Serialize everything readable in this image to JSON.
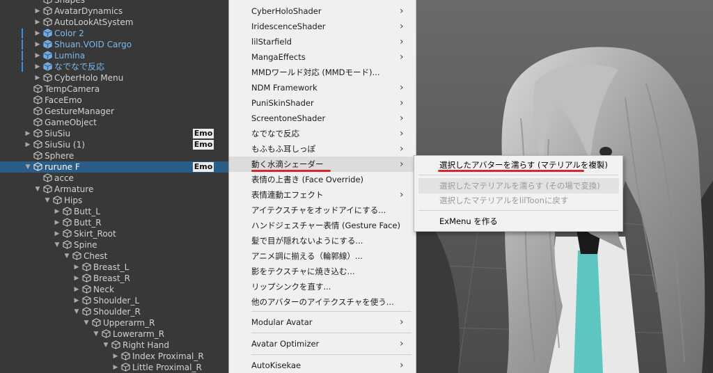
{
  "hierarchy": {
    "rows": [
      {
        "label": "Shapes",
        "indent": 0,
        "arrow": "",
        "style": "normal",
        "mark": false,
        "badge": ""
      },
      {
        "label": "AvatarDynamics",
        "indent": 0,
        "arrow": "right",
        "style": "normal",
        "mark": false,
        "badge": ""
      },
      {
        "label": "AutoLookAtSystem",
        "indent": 0,
        "arrow": "right",
        "style": "normal",
        "mark": false,
        "badge": ""
      },
      {
        "label": "Color 2",
        "indent": 0,
        "arrow": "right",
        "style": "blue",
        "mark": true,
        "badge": ""
      },
      {
        "label": "Shuan.VOID Cargo",
        "indent": 0,
        "arrow": "right",
        "style": "blue",
        "mark": true,
        "badge": ""
      },
      {
        "label": "Lumina",
        "indent": 0,
        "arrow": "right",
        "style": "blue",
        "mark": true,
        "badge": ""
      },
      {
        "label": "なでなで反応",
        "indent": 0,
        "arrow": "right",
        "style": "blue",
        "mark": true,
        "badge": ""
      },
      {
        "label": "CyberHolo Menu",
        "indent": 0,
        "arrow": "right",
        "style": "normal",
        "mark": false,
        "badge": ""
      },
      {
        "label": "TempCamera",
        "indent": -1,
        "arrow": "",
        "style": "normal",
        "mark": false,
        "badge": ""
      },
      {
        "label": "FaceEmo",
        "indent": -1,
        "arrow": "",
        "style": "normal",
        "mark": false,
        "badge": ""
      },
      {
        "label": "GestureManager",
        "indent": -1,
        "arrow": "",
        "style": "normal",
        "mark": false,
        "badge": ""
      },
      {
        "label": "GameObject",
        "indent": -1,
        "arrow": "",
        "style": "normal",
        "mark": false,
        "badge": ""
      },
      {
        "label": "SiuSiu",
        "indent": -1,
        "arrow": "right",
        "style": "normal",
        "mark": false,
        "badge": "Emo"
      },
      {
        "label": "SiuSiu (1)",
        "indent": -1,
        "arrow": "right",
        "style": "normal",
        "mark": false,
        "badge": "Emo"
      },
      {
        "label": "Sphere",
        "indent": -1,
        "arrow": "",
        "style": "normal",
        "mark": false,
        "badge": ""
      },
      {
        "label": "rurune F",
        "indent": -1,
        "arrow": "down",
        "style": "white",
        "mark": false,
        "badge": "Emo",
        "selected": true
      },
      {
        "label": "acce",
        "indent": 0,
        "arrow": "",
        "style": "normal",
        "mark": false,
        "badge": ""
      },
      {
        "label": "Armature",
        "indent": 0,
        "arrow": "down",
        "style": "normal",
        "mark": false,
        "badge": ""
      },
      {
        "label": "Hips",
        "indent": 1,
        "arrow": "down",
        "style": "normal",
        "mark": false,
        "badge": ""
      },
      {
        "label": "Butt_L",
        "indent": 2,
        "arrow": "right",
        "style": "normal",
        "mark": false,
        "badge": ""
      },
      {
        "label": "Butt_R",
        "indent": 2,
        "arrow": "right",
        "style": "normal",
        "mark": false,
        "badge": ""
      },
      {
        "label": "Skirt_Root",
        "indent": 2,
        "arrow": "right",
        "style": "normal",
        "mark": false,
        "badge": ""
      },
      {
        "label": "Spine",
        "indent": 2,
        "arrow": "down",
        "style": "normal",
        "mark": false,
        "badge": ""
      },
      {
        "label": "Chest",
        "indent": 3,
        "arrow": "down",
        "style": "normal",
        "mark": false,
        "badge": ""
      },
      {
        "label": "Breast_L",
        "indent": 4,
        "arrow": "right",
        "style": "normal",
        "mark": false,
        "badge": ""
      },
      {
        "label": "Breast_R",
        "indent": 4,
        "arrow": "right",
        "style": "normal",
        "mark": false,
        "badge": ""
      },
      {
        "label": "Neck",
        "indent": 4,
        "arrow": "right",
        "style": "normal",
        "mark": false,
        "badge": ""
      },
      {
        "label": "Shoulder_L",
        "indent": 4,
        "arrow": "right",
        "style": "normal",
        "mark": false,
        "badge": ""
      },
      {
        "label": "Shoulder_R",
        "indent": 4,
        "arrow": "down",
        "style": "normal",
        "mark": false,
        "badge": ""
      },
      {
        "label": "Upperarm_R",
        "indent": 5,
        "arrow": "down",
        "style": "normal",
        "mark": false,
        "badge": ""
      },
      {
        "label": "Lowerarm_R",
        "indent": 6,
        "arrow": "down",
        "style": "normal",
        "mark": false,
        "badge": ""
      },
      {
        "label": "Right Hand",
        "indent": 7,
        "arrow": "down",
        "style": "normal",
        "mark": false,
        "badge": ""
      },
      {
        "label": "Index Proximal_R",
        "indent": 8,
        "arrow": "right",
        "style": "normal",
        "mark": false,
        "badge": ""
      },
      {
        "label": "Little Proximal_R",
        "indent": 8,
        "arrow": "right",
        "style": "normal",
        "mark": false,
        "badge": ""
      }
    ]
  },
  "menu": {
    "items": [
      {
        "label": "CyberHoloShader",
        "submenu": true
      },
      {
        "label": "IridescenceShader",
        "submenu": true
      },
      {
        "label": "lilStarfield",
        "submenu": true
      },
      {
        "label": "MangaEffects",
        "submenu": true
      },
      {
        "label": "MMDワールド対応 (MMDモード)...",
        "submenu": false
      },
      {
        "label": "NDM Framework",
        "submenu": true
      },
      {
        "label": "PuniSkinShader",
        "submenu": true
      },
      {
        "label": "ScreentoneShader",
        "submenu": true
      },
      {
        "label": "なでなで反応",
        "submenu": true
      },
      {
        "label": "もふもふ耳しっぽ",
        "submenu": true
      },
      {
        "label": "動く水滴シェーダー",
        "submenu": true,
        "highlighted": true
      },
      {
        "label": "表情の上書き (Face Override)",
        "submenu": false
      },
      {
        "label": "表情連動エフェクト",
        "submenu": true
      },
      {
        "label": "アイテクスチャをオッドアイにする...",
        "submenu": false
      },
      {
        "label": "ハンドジェスチャー表情 (Gesture Face)",
        "submenu": false
      },
      {
        "label": "髪で目が隠れないようにする...",
        "submenu": false
      },
      {
        "label": "アニメ調に揃える（輪郭線）...",
        "submenu": false
      },
      {
        "label": "影をテクスチャに焼き込む...",
        "submenu": false
      },
      {
        "label": "リップシンクを直す...",
        "submenu": false
      },
      {
        "label": "他のアバターのアイテクスチャを使う...",
        "submenu": false
      }
    ],
    "bottom_items": [
      {
        "label": "Modular Avatar",
        "submenu": true
      },
      {
        "label": "Avatar Optimizer",
        "submenu": true
      },
      {
        "label": "AutoKisekae",
        "submenu": true
      }
    ],
    "submenu_arrow": "›"
  },
  "submenu": {
    "items": [
      {
        "label": "選択したアバターを濡らす (マテリアルを複製)",
        "disabled": false
      },
      {
        "label": "選択したマテリアルを濡らす (その場で変換)",
        "disabled": true,
        "highlighted": true
      },
      {
        "label": "選択したマテリアルをlilToonに戻す",
        "disabled": true
      },
      {
        "label": "ExMenu を作る",
        "disabled": false
      }
    ]
  },
  "colors": {
    "selection": "#2c5d87",
    "annotation_underline": "#d8262d",
    "prefab_blue": "#7cb9f0"
  }
}
